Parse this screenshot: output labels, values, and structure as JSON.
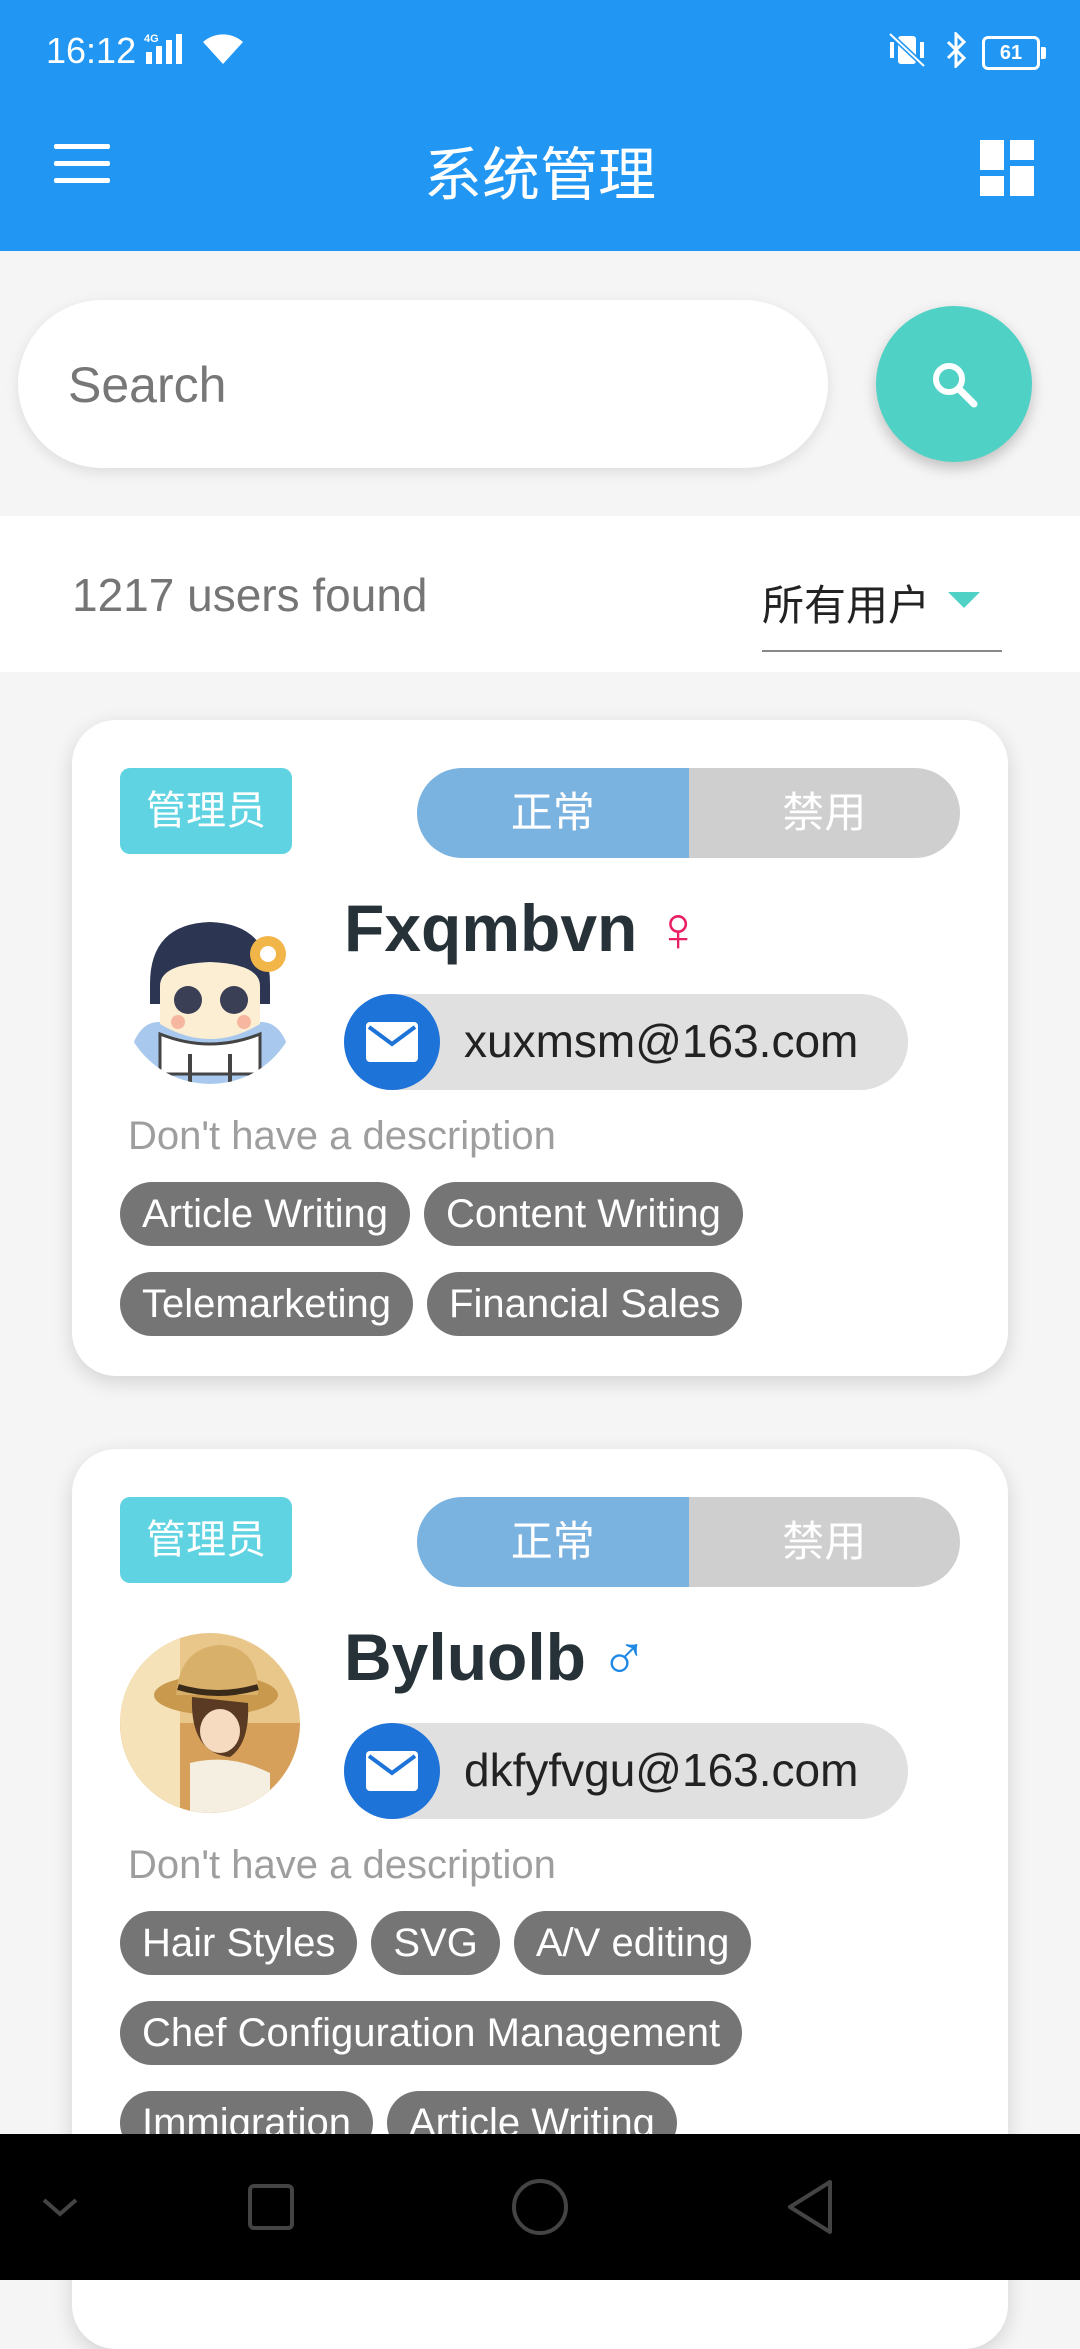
{
  "status_bar": {
    "time": "16:12",
    "network": "4G",
    "battery": "61"
  },
  "app_bar": {
    "title": "系统管理",
    "menu_icon": "menu-icon",
    "grid_icon": "dashboard-icon"
  },
  "search": {
    "placeholder": "Search",
    "button_icon": "search-icon"
  },
  "results": {
    "count_text": "1217 users found",
    "filter_value": "所有用户"
  },
  "colors": {
    "primary": "#2196f3",
    "accent": "#4fd1c5",
    "badge": "#5fd3e2",
    "female": "#e91e63",
    "male": "#1e88e5"
  },
  "users": [
    {
      "role": "管理员",
      "status_on": "正常",
      "status_off": "禁用",
      "name": "Fxqmbvn",
      "gender_symbol": "♀",
      "email": "xuxmsm@163.com",
      "description": "Don't have a description",
      "tags": [
        "Article Writing",
        "Content Writing",
        "Telemarketing",
        "Financial Sales"
      ]
    },
    {
      "role": "管理员",
      "status_on": "正常",
      "status_off": "禁用",
      "name": "Byluolb",
      "gender_symbol": "♂",
      "email": "dkfyfvgu@163.com",
      "description": "Don't have a description",
      "tags": [
        "Hair Styles",
        "SVG",
        "A/V editing",
        "Chef Configuration Management",
        "Immigration",
        "Article Writing"
      ]
    }
  ],
  "nav": {
    "icons": [
      "nav-hide-icon",
      "recents-icon",
      "home-icon",
      "back-icon"
    ]
  }
}
